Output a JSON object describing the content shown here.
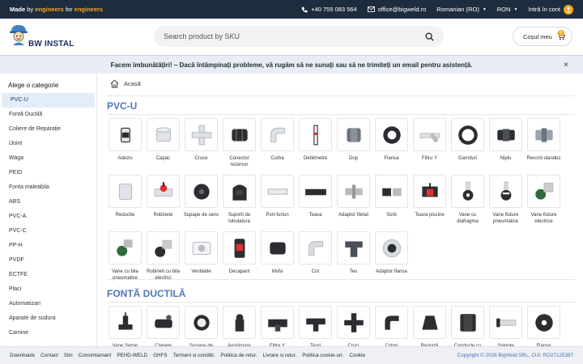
{
  "topbar": {
    "made_1": "Made",
    "made_2": "by",
    "made_3": "engineers",
    "made_4": "for",
    "made_5": "engineers",
    "phone": "+40 755 083 564",
    "email": "office@bigweld.ro",
    "language": "Romanian (RO)",
    "currency": "RON",
    "account": "Intră în cont"
  },
  "header": {
    "logo_text": "BW INSTAL",
    "search_placeholder": "Search product by SKU",
    "cart_label": "Coșul meu",
    "cart_count": "0"
  },
  "notice": {
    "text": "Facem îmbunătățiri! – Dacă întâmpinați probleme, vă rugăm să ne sunați sau să ne trimiteți un email pentru asistență.",
    "close": "×"
  },
  "sidebar": {
    "title": "Alege o categorie",
    "items": [
      "PVC-U",
      "Fontă Ductilă",
      "Coliere de Reparație",
      "iJoint",
      "Waga",
      "PEID",
      "Fonta maleabila",
      "ABS",
      "PVC-A",
      "PVC-C",
      "PP-H",
      "PVDF",
      "ECTFE",
      "Placi",
      "Automatizari",
      "Aparate de sudura",
      "Camine"
    ]
  },
  "breadcrumb": {
    "home": "Acasă"
  },
  "sections": [
    {
      "title": "PVC-U",
      "products": [
        {
          "name": "Adeziv",
          "icon": "glue-can-icon"
        },
        {
          "name": "Capac",
          "icon": "cap-icon"
        },
        {
          "name": "Cruce",
          "icon": "cross-fitting-icon"
        },
        {
          "name": "Conector rezervor",
          "icon": "tank-connector-icon"
        },
        {
          "name": "Curba",
          "icon": "bend-icon"
        },
        {
          "name": "Debitmetre",
          "icon": "flowmeter-icon"
        },
        {
          "name": "Dop",
          "icon": "plug-icon"
        },
        {
          "name": "Flansa",
          "icon": "flange-icon"
        },
        {
          "name": "Filtru Y",
          "icon": "y-filter-icon"
        },
        {
          "name": "Garnituri",
          "icon": "gasket-icon"
        },
        {
          "name": "Niplu",
          "icon": "nipple-icon"
        },
        {
          "name": "Record olandez",
          "icon": "union-icon"
        },
        {
          "name": "Reductie",
          "icon": "reducer-icon"
        },
        {
          "name": "Robinete",
          "icon": "ball-valve-icon"
        },
        {
          "name": "Supape de sens",
          "icon": "check-valve-icon"
        },
        {
          "name": "Suporti de tubulatura",
          "icon": "pipe-support-icon"
        },
        {
          "name": "Port-furtun",
          "icon": "hose-tail-icon"
        },
        {
          "name": "Teava",
          "icon": "pipe-icon"
        },
        {
          "name": "Adaptor filetat",
          "icon": "threaded-adapter-icon"
        },
        {
          "name": "Sorb",
          "icon": "foot-valve-icon"
        },
        {
          "name": "Teava piscine",
          "icon": "pool-pipe-icon"
        },
        {
          "name": "Vane cu diafragma",
          "icon": "diaphragm-valve-icon"
        },
        {
          "name": "Vane fluture pneumatice",
          "icon": "pneumatic-butterfly-valve-icon"
        },
        {
          "name": "Vane fluture electrice",
          "icon": "electric-butterfly-valve-icon"
        },
        {
          "name": "Vane cu bila pneumatice",
          "icon": "pneumatic-ball-valve-icon"
        },
        {
          "name": "Robineti cu bila electrici",
          "icon": "electric-ball-valve-icon"
        },
        {
          "name": "Ventilatie",
          "icon": "ventilation-icon"
        },
        {
          "name": "Decapant",
          "icon": "cleaner-can-icon"
        },
        {
          "name": "Mufa",
          "icon": "coupling-icon"
        },
        {
          "name": "Cot",
          "icon": "elbow-icon"
        },
        {
          "name": "Teu",
          "icon": "tee-icon"
        },
        {
          "name": "Adaptor flansa",
          "icon": "flange-adapter-icon"
        }
      ]
    },
    {
      "title": "FONTĂ DUCTILĂ",
      "products": [
        {
          "name": "Vane Sertar",
          "icon": "gate-valve-icon"
        },
        {
          "name": "Clapete",
          "icon": "swing-check-icon"
        },
        {
          "name": "Supape de",
          "icon": "ductile-valve-icon"
        },
        {
          "name": "Aerisitoare",
          "icon": "air-valve-icon"
        },
        {
          "name": "Filtre Y",
          "icon": "ductile-y-filter-icon"
        },
        {
          "name": "Teuri",
          "icon": "ductile-tee-icon"
        },
        {
          "name": "Cruci",
          "icon": "ductile-cross-icon"
        },
        {
          "name": "Coturi",
          "icon": "ductile-elbow-icon"
        },
        {
          "name": "Reducții",
          "icon": "ductile-reducer-icon"
        },
        {
          "name": "Conducte cu",
          "icon": "ductile-pipe-icon"
        },
        {
          "name": "Spigote",
          "icon": "spigot-icon"
        },
        {
          "name": "Flanșe",
          "icon": "ductile-flange-icon"
        }
      ]
    }
  ],
  "footer": {
    "links": [
      "Downloads",
      "Contact",
      "Stiri",
      "Consimtamant",
      "PEHD-WELD",
      "GHFS",
      "Termeni si conditii.",
      "Politica de retur.",
      "Livrare si retur.",
      "Politica cookie-uri.",
      "Cookie"
    ],
    "copyright": "Copyright © 2026 BigWeld SRL, CUI: RO27125387"
  },
  "colors": {
    "topbar": "#1e2d3d",
    "accent": "#f5a623",
    "section_title": "#5177b8",
    "notice_bg": "#e8edf5"
  }
}
